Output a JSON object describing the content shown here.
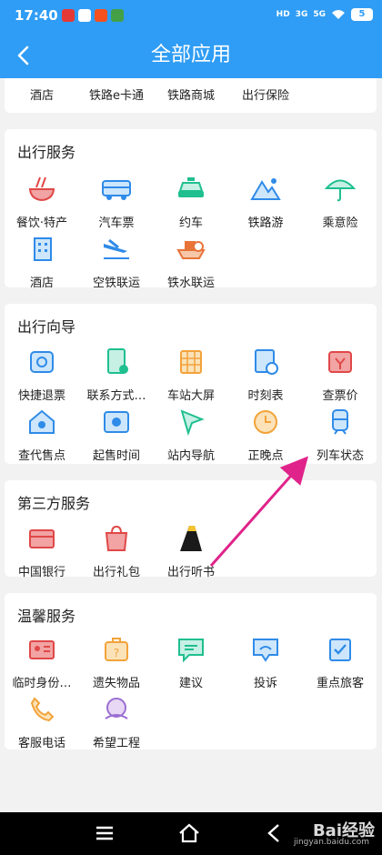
{
  "statusbar": {
    "time": "17:40",
    "network1": "HD",
    "network2": "3G",
    "network3": "5G",
    "battery": "5"
  },
  "header": {
    "title": "全部应用",
    "back_icon": "chevron-left-icon"
  },
  "top_card": {
    "items": [
      "酒店",
      "铁路e卡通",
      "铁路商城",
      "出行保险"
    ]
  },
  "travel_services": {
    "title": "出行服务",
    "items": [
      "餐饮·特产",
      "汽车票",
      "约车",
      "铁路游",
      "乘意险",
      "酒店",
      "空铁联运",
      "铁水联运"
    ]
  },
  "travel_guide": {
    "title": "出行向导",
    "items": [
      "快捷退票",
      "联系方式…",
      "车站大屏",
      "时刻表",
      "查票价",
      "查代售点",
      "起售时间",
      "站内导航",
      "正晚点",
      "列车状态"
    ]
  },
  "third_party": {
    "title": "第三方服务",
    "items": [
      "中国银行",
      "出行礼包",
      "出行听书"
    ]
  },
  "warm_services": {
    "title": "温馨服务",
    "items": [
      "临时身份…",
      "遗失物品",
      "建议",
      "投诉",
      "重点旅客",
      "客服电话",
      "希望工程"
    ]
  },
  "colors": {
    "accent": "#2f9df5",
    "arrow": "#e0238a"
  },
  "watermark": {
    "text": "Bai经验",
    "sub": "jingyan.baidu.com"
  }
}
